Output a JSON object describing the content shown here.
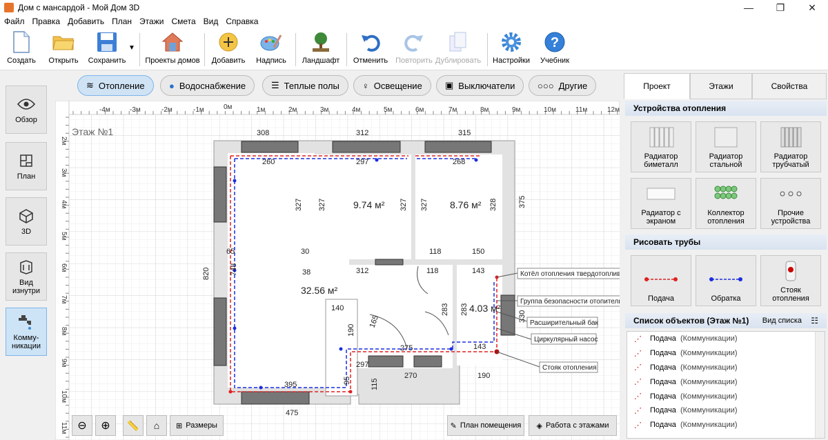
{
  "window": {
    "title": "Дом с мансардой - Мой Дом 3D",
    "minimize": "—",
    "maximize": "❐",
    "close": "✕"
  },
  "menu": [
    "Файл",
    "Правка",
    "Добавить",
    "План",
    "Этажи",
    "Смета",
    "Вид",
    "Справка"
  ],
  "toolbar": {
    "create": "Создать",
    "open": "Открыть",
    "save": "Сохранить",
    "projects": "Проекты домов",
    "add": "Добавить",
    "label": "Надпись",
    "landscape": "Ландшафт",
    "undo": "Отменить",
    "redo": "Повторить",
    "duplicate": "Дублировать",
    "settings": "Настройки",
    "tutorial": "Учебник"
  },
  "left": {
    "overview": "Обзор",
    "plan": "План",
    "view3d": "3D",
    "inside": "Вид изнутри",
    "comm": "Комму-никации"
  },
  "filters": [
    "Отопление",
    "Водоснабжение",
    "Теплые полы",
    "Освещение",
    "Выключатели",
    "Другие"
  ],
  "canvas": {
    "floor_label": "Этаж №1",
    "ruler_x": [
      "-4м",
      "-3м",
      "-2м",
      "-1м",
      "0м",
      "1м",
      "2м",
      "3м",
      "4м",
      "5м",
      "6м",
      "7м",
      "8м",
      "9м",
      "10м",
      "11м",
      "12м"
    ],
    "ruler_y": [
      "2м",
      "3м",
      "4м",
      "5м",
      "6м",
      "7м",
      "8м",
      "9м",
      "10м",
      "11м"
    ],
    "dims": {
      "d308": "308",
      "d312": "312",
      "d315": "315",
      "d260": "260",
      "d297a": "297",
      "d268": "268",
      "d327a": "327",
      "d327b": "327",
      "d327c": "327",
      "d328": "328",
      "d375": "375",
      "d820": "820",
      "d65": "65",
      "d30": "30",
      "d297b": "297",
      "d118a": "118",
      "d150": "150",
      "d38": "38",
      "d312b": "312",
      "d118b": "118",
      "d143a": "143",
      "d748": "748",
      "d140": "140",
      "d190a": "190",
      "d165": "165",
      "d283a": "283",
      "d283b": "283",
      "d330": "330",
      "d275": "275",
      "d143b": "143",
      "d95": "95",
      "d115": "115",
      "d270": "270",
      "d190b": "190",
      "d395": "395",
      "d475": "475"
    },
    "areas": {
      "a1": "9.74 м²",
      "a2": "8.76 м²",
      "a3": "32.56 м²",
      "a4": "4.03 м²"
    },
    "callouts": [
      "Котёл отопления твердотопливн",
      "Группа безопасности отопительн",
      "Расширительный бак",
      "Циркулярный насос",
      "Стояк отопления"
    ],
    "bottom": {
      "sizes": "Размеры",
      "room_plan": "План помещения",
      "floors_work": "Работа с этажами"
    }
  },
  "right": {
    "tabs": [
      "Проект",
      "Этажи",
      "Свойства"
    ],
    "heating_head": "Устройства отопления",
    "devices": [
      "Радиатор биметалл",
      "Радиатор стальной",
      "Радиатор трубчатый",
      "Радиатор с экраном",
      "Коллектор отопления",
      "Прочие устройства"
    ],
    "pipes_head": "Рисовать трубы",
    "pipes": [
      "Подача",
      "Обратка",
      "Стояк отопления"
    ],
    "list_head": "Список объектов (Этаж №1)",
    "list_view": "Вид списка",
    "list_items": [
      {
        "name": "Подача",
        "cat": "(Коммуникации)"
      },
      {
        "name": "Подача",
        "cat": "(Коммуникации)"
      },
      {
        "name": "Подача",
        "cat": "(Коммуникации)"
      },
      {
        "name": "Подача",
        "cat": "(Коммуникации)"
      },
      {
        "name": "Подача",
        "cat": "(Коммуникации)"
      },
      {
        "name": "Подача",
        "cat": "(Коммуникации)"
      },
      {
        "name": "Подача",
        "cat": "(Коммуникации)"
      }
    ]
  },
  "colors": {
    "supply": "#e02020",
    "return": "#1a2ee0",
    "accent": "#cde4f7"
  }
}
